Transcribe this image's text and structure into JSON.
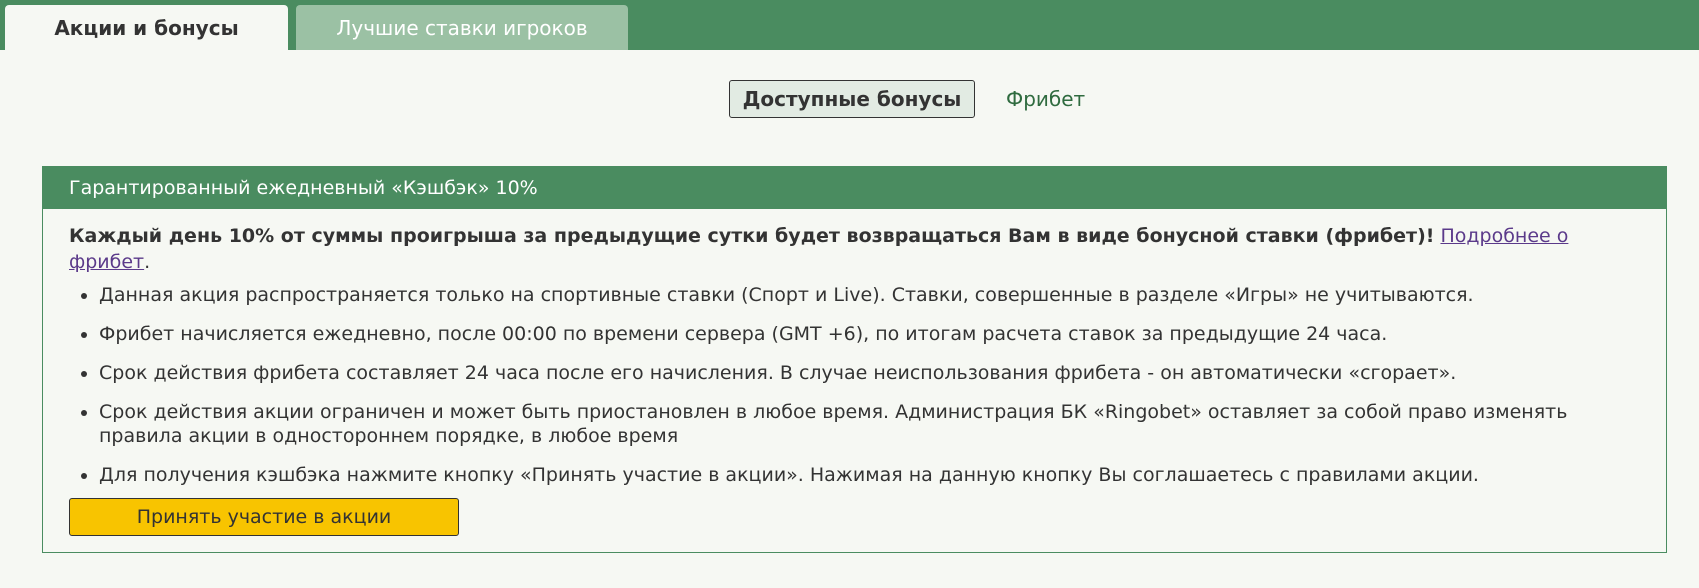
{
  "tabs": {
    "active": "Акции и бонусы",
    "inactive": "Лучшие ставки игроков"
  },
  "subtabs": {
    "active": "Доступные бонусы",
    "link": "Фрибет"
  },
  "promo": {
    "title": "Гарантированный ежедневный «Кэшбэк» 10%",
    "lead_bold": "Каждый день 10% от суммы проигрыша за предыдущие сутки будет возвращаться Вам в виде бонусной ставки (фрибет)!",
    "lead_link": "Подробнее о фрибет",
    "lead_tail": ".",
    "rules": [
      "Данная акция распространяется только на спортивные ставки (Спорт и Live). Ставки, совершенные в разделе «Игры» не учитываются.",
      "Фрибет начисляется ежедневно, после 00:00 по времени сервера (GMT +6), по итогам расчета ставок за предыдущие 24 часа.",
      "Срок действия фрибета составляет 24 часа после его начисления. В случае неиспользования фрибета - он автоматически «сгорает».",
      "Срок действия акции ограничен и может быть приостановлен в любое время. Администрация БК «Ringobet» оставляет за собой право изменять правила акции в одностороннем порядке, в любое время",
      "Для получения кэшбэка нажмите кнопку «Принять участие в акции». Нажимая на данную кнопку Вы соглашаетесь с правилами акции."
    ],
    "button_label": "Принять участие в акции"
  },
  "colors": {
    "brand_green": "#4a8c60",
    "inactive_tab": "#9bc1a4",
    "button_yellow": "#f8c400",
    "background": "#f6f8f3"
  }
}
